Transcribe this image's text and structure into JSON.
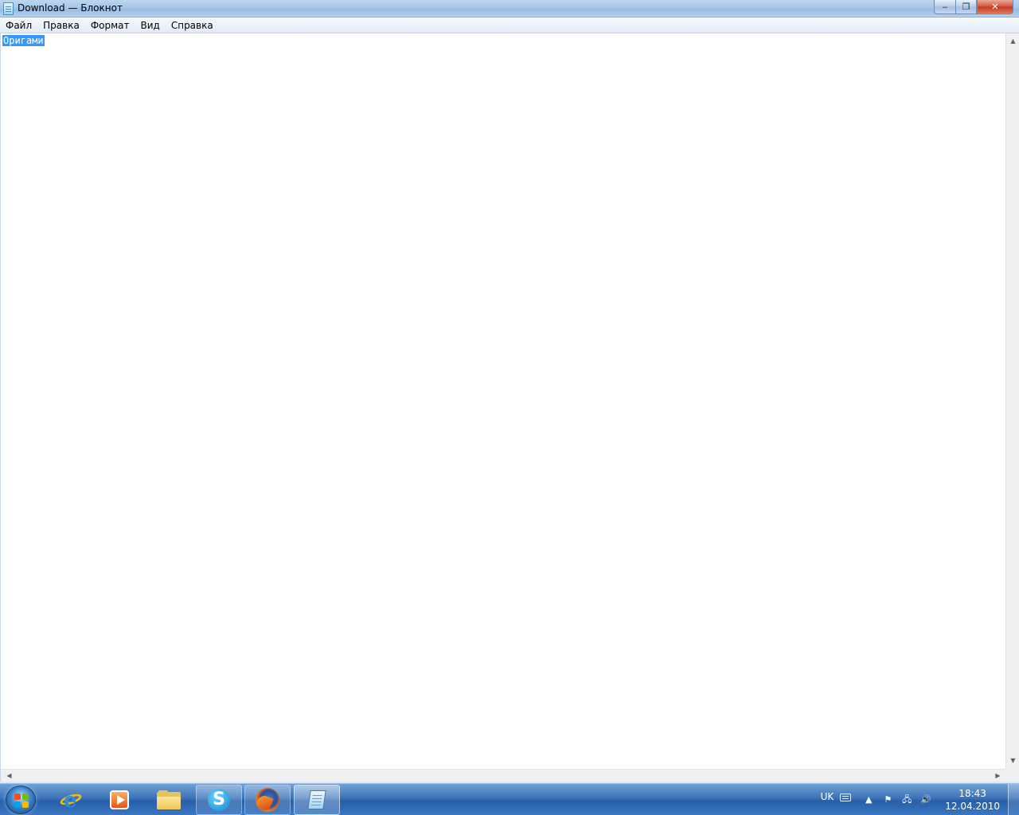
{
  "window": {
    "title": "Download — Блокнот",
    "buttons": {
      "minimize": "‒",
      "maximize": "❐",
      "close": "✕"
    }
  },
  "menu": {
    "items": [
      "Файл",
      "Правка",
      "Формат",
      "Вид",
      "Справка"
    ]
  },
  "editor": {
    "selected_text": "Оригами"
  },
  "taskbar": {
    "apps": [
      {
        "name": "internet-explorer",
        "state": "pinned"
      },
      {
        "name": "windows-media-player",
        "state": "pinned"
      },
      {
        "name": "windows-explorer",
        "state": "pinned"
      },
      {
        "name": "skype",
        "state": "running"
      },
      {
        "name": "firefox",
        "state": "running"
      },
      {
        "name": "notepad",
        "state": "active"
      }
    ],
    "tray": {
      "language": "UK",
      "time": "18:43",
      "date": "12.04.2010"
    }
  },
  "colors": {
    "selection": "#3399ff",
    "taskbar": "#275ea8"
  }
}
